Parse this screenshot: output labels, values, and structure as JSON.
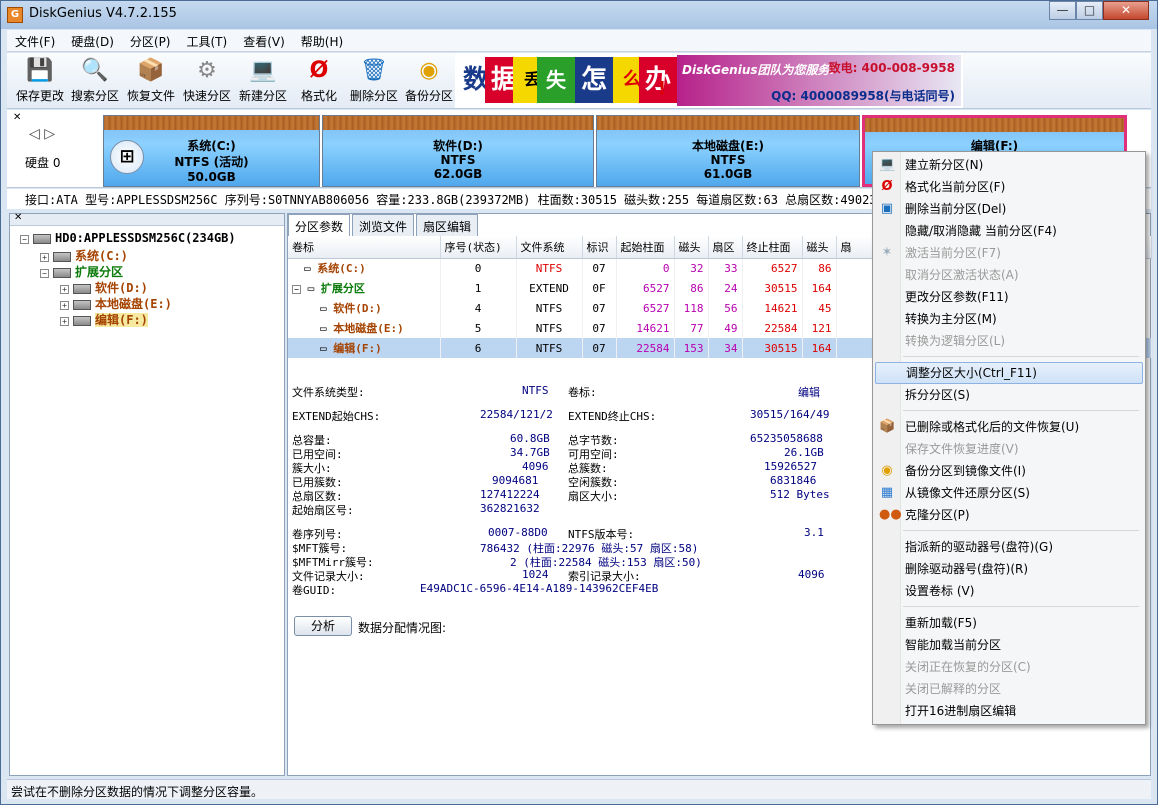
{
  "window": {
    "title": "DiskGenius V4.7.2.155",
    "app_icon": "G"
  },
  "menubar": [
    "文件(F)",
    "硬盘(D)",
    "分区(P)",
    "工具(T)",
    "查看(V)",
    "帮助(H)"
  ],
  "toolbar": [
    {
      "label": "保存更改",
      "icon": "save-icon"
    },
    {
      "label": "搜索分区",
      "icon": "search-icon"
    },
    {
      "label": "恢复文件",
      "icon": "recover-icon"
    },
    {
      "label": "快速分区",
      "icon": "quick-partition-icon"
    },
    {
      "label": "新建分区",
      "icon": "new-partition-icon"
    },
    {
      "label": "格式化",
      "icon": "format-icon"
    },
    {
      "label": "删除分区",
      "icon": "delete-icon"
    },
    {
      "label": "备份分区",
      "icon": "backup-icon"
    }
  ],
  "banner": {
    "chars": [
      "数",
      "据",
      "丢",
      "失",
      "怎",
      "么",
      "办",
      "!"
    ],
    "slogan": "DiskGenius团队为您服务!",
    "phone": "致电: 400-008-9958",
    "qq": "QQ: 4000089958(与电话同号)"
  },
  "diskbar": {
    "disk_label": "硬盘 0",
    "partitions": [
      {
        "name": "系统(C:)",
        "fs": "NTFS (活动)",
        "size": "50.0GB"
      },
      {
        "name": "软件(D:)",
        "fs": "NTFS",
        "size": "62.0GB"
      },
      {
        "name": "本地磁盘(E:)",
        "fs": "NTFS",
        "size": "61.0GB"
      },
      {
        "name": "编辑(F:)",
        "fs": "",
        "size": ""
      }
    ]
  },
  "infobar": "接口:ATA  型号:APPLESSDSM256C  序列号:S0TNNYAB806056  容量:233.8GB(239372MB)  柱面数:30515  磁头数:255  每道扇区数:63  总扇区数:490234752",
  "tree": {
    "root": "HD0:APPLESSDSM256C(234GB)",
    "items": [
      "系统(C:)",
      "扩展分区",
      "软件(D:)",
      "本地磁盘(E:)",
      "编辑(F:)"
    ]
  },
  "tabs": [
    "分区参数",
    "浏览文件",
    "扇区编辑"
  ],
  "table": {
    "headers": [
      "卷标",
      "序号(状态)",
      "文件系统",
      "标识",
      "起始柱面",
      "磁头",
      "扇区",
      "终止柱面",
      "磁头",
      "扇"
    ],
    "rows": [
      {
        "name": "系统(C:)",
        "idx": "0",
        "fs": "NTFS",
        "id": "07",
        "sc": "0",
        "sh": "32",
        "ss": "33",
        "ec": "6527",
        "eh": "86"
      },
      {
        "name": "扩展分区",
        "idx": "1",
        "fs": "EXTEND",
        "id": "0F",
        "sc": "6527",
        "sh": "86",
        "ss": "24",
        "ec": "30515",
        "eh": "164"
      },
      {
        "name": "软件(D:)",
        "idx": "4",
        "fs": "NTFS",
        "id": "07",
        "sc": "6527",
        "sh": "118",
        "ss": "56",
        "ec": "14621",
        "eh": "45"
      },
      {
        "name": "本地磁盘(E:)",
        "idx": "5",
        "fs": "NTFS",
        "id": "07",
        "sc": "14621",
        "sh": "77",
        "ss": "49",
        "ec": "22584",
        "eh": "121"
      },
      {
        "name": "编辑(F:)",
        "idx": "6",
        "fs": "NTFS",
        "id": "07",
        "sc": "22584",
        "sh": "153",
        "ss": "34",
        "ec": "30515",
        "eh": "164"
      }
    ]
  },
  "details": {
    "fs_type_label": "文件系统类型:",
    "fs_type": "NTFS",
    "vol_label_label": "卷标:",
    "vol_label": "编辑",
    "chs_start_label": "EXTEND起始CHS:",
    "chs_start": "22584/121/2",
    "chs_end_label": "EXTEND终止CHS:",
    "chs_end": "30515/164/49",
    "total_label": "总容量:",
    "total": "60.8GB",
    "total_bytes_label": "总字节数:",
    "total_bytes": "65235058688",
    "used_label": "已用空间:",
    "used": "34.7GB",
    "free_label": "可用空间:",
    "free": "26.1GB",
    "cluster_label": "簇大小:",
    "cluster": "4096",
    "clusters_label": "总簇数:",
    "clusters": "15926527",
    "used_clusters_label": "已用簇数:",
    "used_clusters": "9094681",
    "free_clusters_label": "空闲簇数:",
    "free_clusters": "6831846",
    "sectors_label": "总扇区数:",
    "sectors": "127412224",
    "sector_size_label": "扇区大小:",
    "sector_size": "512 Bytes",
    "start_sector_label": "起始扇区号:",
    "start_sector": "362821632",
    "serial_label": "卷序列号:",
    "serial": "0007-88D0",
    "ntfs_ver_label": "NTFS版本号:",
    "ntfs_ver": "3.1",
    "mft_label": "$MFT簇号:",
    "mft": "786432 (柱面:22976 磁头:57 扇区:58)",
    "mftmirr_label": "$MFTMirr簇号:",
    "mftmirr": "2 (柱面:22584 磁头:153 扇区:50)",
    "record_label": "文件记录大小:",
    "record": "1024",
    "index_label": "索引记录大小:",
    "index": "4096",
    "guid_label": "卷GUID:",
    "guid": "E49ADC1C-6596-4E14-A189-143962CEF4EB",
    "analyze_btn": "分析",
    "analyze_label": "数据分配情况图:"
  },
  "context_menu": [
    {
      "label": "建立新分区(N)",
      "icon": "new-partition-icon",
      "disabled": false
    },
    {
      "label": "格式化当前分区(F)",
      "icon": "format-icon",
      "disabled": false
    },
    {
      "label": "删除当前分区(Del)",
      "icon": "delete-icon",
      "disabled": false
    },
    {
      "label": "隐藏/取消隐藏 当前分区(F4)",
      "icon": "",
      "disabled": false
    },
    {
      "label": "激活当前分区(F7)",
      "icon": "activate-icon",
      "disabled": true
    },
    {
      "label": "取消分区激活状态(A)",
      "icon": "",
      "disabled": true
    },
    {
      "label": "更改分区参数(F11)",
      "icon": "",
      "disabled": false
    },
    {
      "label": "转换为主分区(M)",
      "icon": "",
      "disabled": false
    },
    {
      "label": "转换为逻辑分区(L)",
      "icon": "",
      "disabled": true
    },
    {
      "label": "调整分区大小(Ctrl_F11)",
      "icon": "",
      "disabled": false,
      "highlight": true
    },
    {
      "label": "拆分分区(S)",
      "icon": "",
      "disabled": false
    },
    {
      "label": "已删除或格式化后的文件恢复(U)",
      "icon": "recover-icon",
      "disabled": false
    },
    {
      "label": "保存文件恢复进度(V)",
      "icon": "",
      "disabled": true
    },
    {
      "label": "备份分区到镜像文件(I)",
      "icon": "backup-icon",
      "disabled": false
    },
    {
      "label": "从镜像文件还原分区(S)",
      "icon": "restore-icon",
      "disabled": false
    },
    {
      "label": "克隆分区(P)",
      "icon": "clone-icon",
      "disabled": false
    },
    {
      "label": "指派新的驱动器号(盘符)(G)",
      "icon": "",
      "disabled": false
    },
    {
      "label": "删除驱动器号(盘符)(R)",
      "icon": "",
      "disabled": false
    },
    {
      "label": "设置卷标 (V)",
      "icon": "",
      "disabled": false
    },
    {
      "label": "重新加载(F5)",
      "icon": "",
      "disabled": false
    },
    {
      "label": "智能加载当前分区",
      "icon": "",
      "disabled": false
    },
    {
      "label": "关闭正在恢复的分区(C)",
      "icon": "",
      "disabled": true
    },
    {
      "label": "关闭已解释的分区",
      "icon": "",
      "disabled": true
    },
    {
      "label": "打开16进制扇区编辑",
      "icon": "",
      "disabled": false
    }
  ],
  "status": "尝试在不删除分区数据的情况下调整分区容量。"
}
